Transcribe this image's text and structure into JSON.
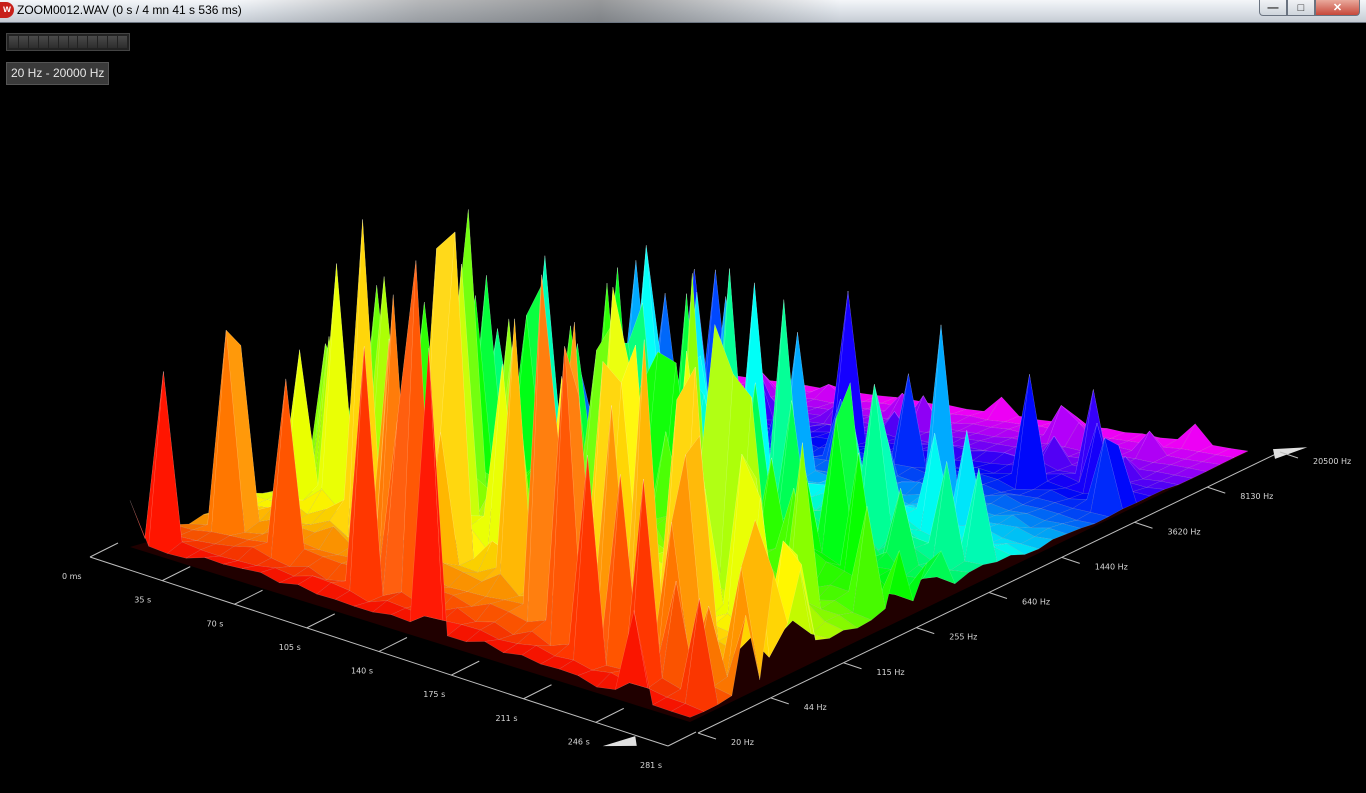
{
  "window": {
    "title": "ZOOM0012.WAV (0 s / 4 mn 41 s 536 ms)",
    "app_icon": "app-logo-icon",
    "controls": {
      "minimize": "minimize-icon",
      "maximize": "maximize-icon",
      "close": "close-icon"
    }
  },
  "range_label": "20 Hz - 20000 Hz",
  "level_meter": {
    "segments": 12
  },
  "chart_data": {
    "type": "3d-surface",
    "title": "",
    "time_axis": {
      "ticks": [
        "0 ms",
        "35 s",
        "70 s",
        "105 s",
        "140 s",
        "175 s",
        "211 s",
        "246 s",
        "281 s"
      ]
    },
    "frequency_axis": {
      "scale": "log",
      "ticks": [
        "20 Hz",
        "44 Hz",
        "115 Hz",
        "255 Hz",
        "640 Hz",
        "1440 Hz",
        "3620 Hz",
        "8130 Hz",
        "20500 Hz"
      ]
    },
    "colormap": [
      "#ff2a2a",
      "#ff7a10",
      "#ffff20",
      "#30ff40",
      "#10e8ff",
      "#2030ff",
      "#d040ff"
    ],
    "grid": true,
    "legend": "none"
  }
}
